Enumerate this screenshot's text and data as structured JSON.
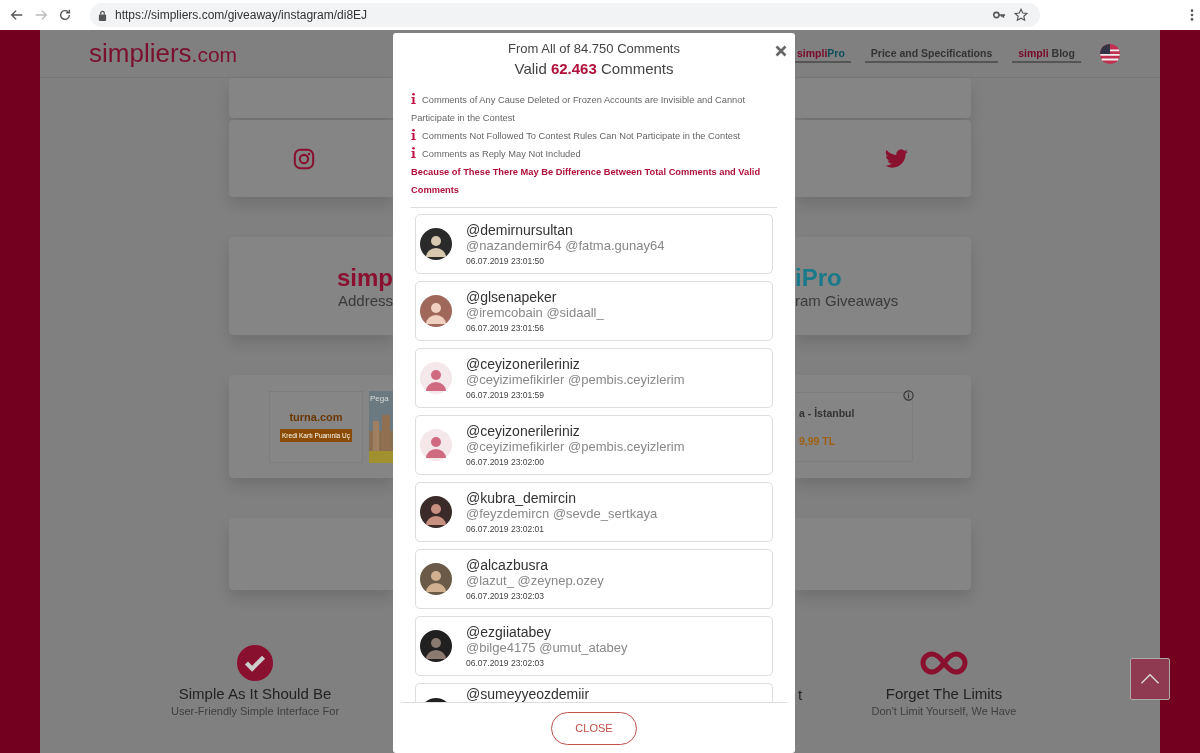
{
  "browser": {
    "url": "https://simpliers.com/giveaway/instagram/di8EJ"
  },
  "header": {
    "logo_main": "simpliers",
    "logo_suffix": ".com",
    "nav": [
      {
        "kind": "pro",
        "brand": "simpli",
        "label": "Pro"
      },
      {
        "kind": "plain",
        "label": "Price and Specifications"
      },
      {
        "kind": "blog",
        "brand": "simpli",
        "label": "Blog"
      }
    ]
  },
  "promo": {
    "left_title": "simp",
    "left_subtitle": "Address",
    "right_title": "iPro",
    "right_subtitle": "ram Giveaways"
  },
  "ad": {
    "brand": "turna.com",
    "button": "Kredi Kartı Puanınla Uç",
    "image_label": "Pega",
    "title": "a - İstanbul",
    "price": "9,99 TL"
  },
  "features": [
    {
      "kind": "check",
      "title": "Simple As It Should Be",
      "subtitle": "User-Friendly Simple Interface For"
    },
    {
      "kind": "partial",
      "title": "t"
    },
    {
      "kind": "infinity",
      "title": "Forget The Limits",
      "subtitle": "Don't Limit Yourself, We Have"
    }
  ],
  "modal": {
    "total": "From All of 84.750 Comments",
    "valid_prefix": "Valid",
    "valid_count": "62.463",
    "valid_suffix": "Comments",
    "notes": [
      "Comments of Any Cause Deleted or Frozen Accounts are Invisible and Cannot Participate in the Contest",
      "Comments Not Followed To Contest Rules Can Not Participate in the Contest",
      "Comments as Reply May Not Included"
    ],
    "warning": "Because of These There May Be Difference Between Total Comments and Valid Comments",
    "comments": [
      {
        "username": "@demirnursultan",
        "mentions": "@nazandemir64 @fatma.gunay64",
        "time": "06.07.2019 23:01:50"
      },
      {
        "username": "@glsenapeker",
        "mentions": "@iremcobain @sidaall_",
        "time": "06.07.2019 23:01:56"
      },
      {
        "username": "@ceyizonerileriniz",
        "mentions": "@ceyizimefikirler @pembis.ceyizlerim",
        "time": "06.07.2019 23:01:59"
      },
      {
        "username": "@ceyizonerileriniz",
        "mentions": "@ceyizimefikirler @pembis.ceyizlerim",
        "time": "06.07.2019 23:02:00"
      },
      {
        "username": "@kubra_demircin",
        "mentions": "@feyzdemircn @sevde_sertkaya",
        "time": "06.07.2019 23:02:01"
      },
      {
        "username": "@alcazbusra",
        "mentions": "@lazut_ @zeynep.ozey",
        "time": "06.07.2019 23:02:03"
      },
      {
        "username": "@ezgiiatabey",
        "mentions": "@bilge4175 @umut_atabey",
        "time": "06.07.2019 23:02:03"
      },
      {
        "username": "@sumeyyeozdemiir"
      }
    ],
    "close_button": "CLOSE"
  }
}
